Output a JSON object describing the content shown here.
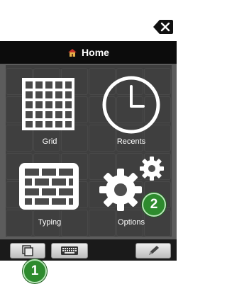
{
  "window": {
    "title": "Home",
    "close_icon": "close-x-icon",
    "home_icon": "house-icon"
  },
  "tiles": [
    {
      "label": "Grid",
      "icon": "grid-icon"
    },
    {
      "label": "Recents",
      "icon": "clock-icon"
    },
    {
      "label": "Typing",
      "icon": "keyboard-bricks-icon"
    },
    {
      "label": "Options",
      "icon": "gears-icon"
    }
  ],
  "bottom_bar": {
    "buttons": [
      {
        "icon": "pages-icon"
      },
      {
        "icon": "keyboard-icon"
      },
      {
        "icon": "pencil-icon"
      }
    ]
  },
  "badges": {
    "options": "2",
    "pages": "1"
  },
  "colors": {
    "badge_green": "#2e8b2e",
    "title_bar": "#0c0c0c",
    "panel_gray": "#5c5c5c"
  }
}
